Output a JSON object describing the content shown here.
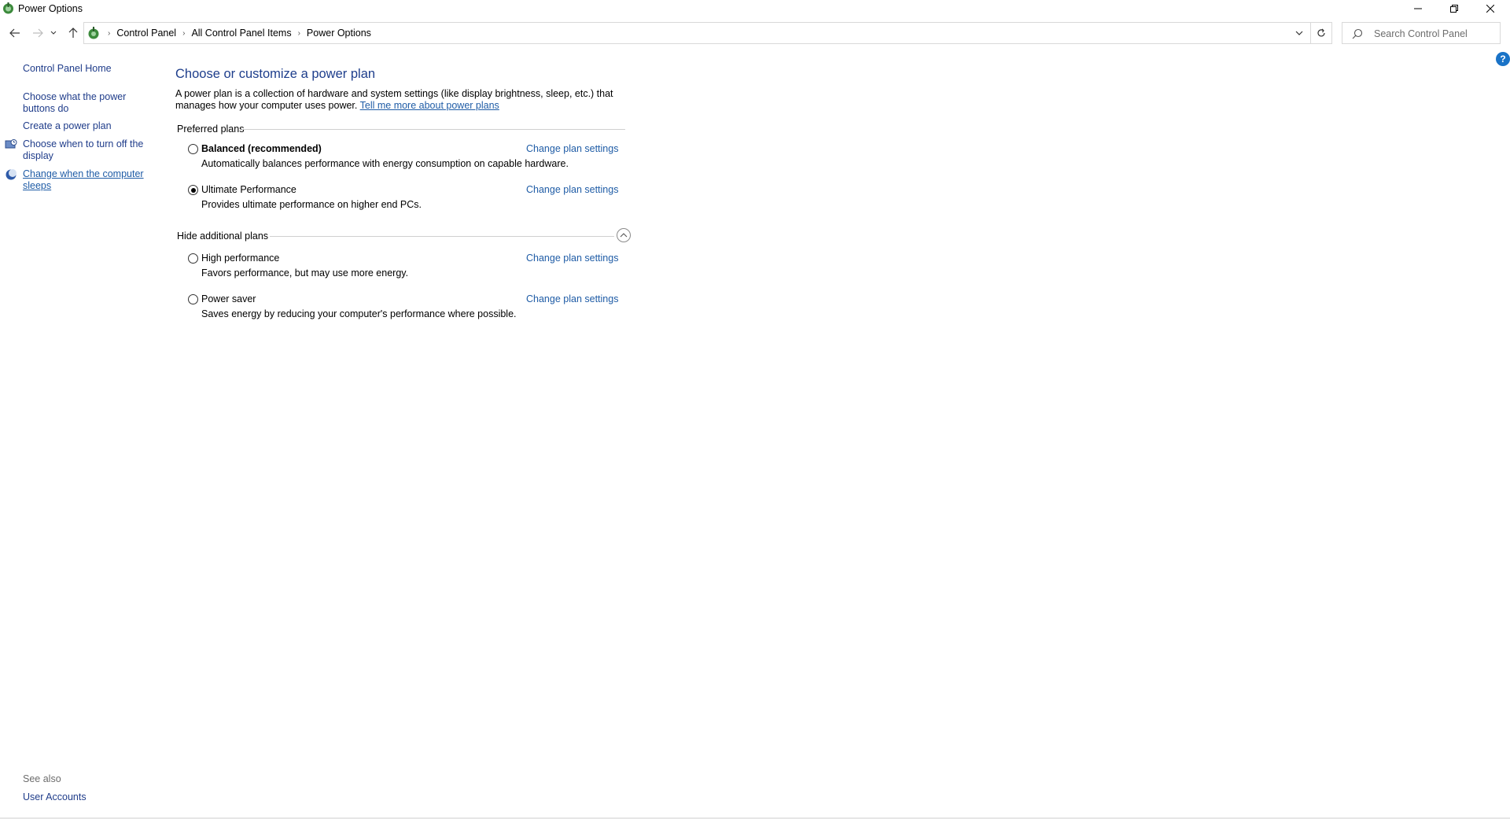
{
  "window": {
    "title": "Power Options"
  },
  "address": {
    "crumbs": [
      "Control Panel",
      "All Control Panel Items",
      "Power Options"
    ]
  },
  "search": {
    "placeholder": "Search Control Panel"
  },
  "left_pane": {
    "home": "Control Panel Home",
    "links": [
      "Choose what the power buttons do",
      "Create a power plan",
      "Choose when to turn off the display",
      "Change when the computer sleeps"
    ],
    "see_also_label": "See also",
    "see_also_links": [
      "User Accounts"
    ]
  },
  "main": {
    "title": "Choose or customize a power plan",
    "intro_text": "A power plan is a collection of hardware and system settings (like display brightness, sleep, etc.) that manages how your computer uses power.",
    "intro_link": "Tell me more about power plans",
    "preferred_heading": "Preferred plans",
    "additional_heading": "Hide additional plans",
    "change_label": "Change plan settings",
    "plans": [
      {
        "name": "Balanced (recommended)",
        "description": "Automatically balances performance with energy consumption on capable hardware.",
        "selected": false
      },
      {
        "name": "Ultimate Performance",
        "description": "Provides ultimate performance on higher end PCs.",
        "selected": true
      },
      {
        "name": "High performance",
        "description": "Favors performance, but may use more energy.",
        "selected": false
      },
      {
        "name": "Power saver",
        "description": "Saves energy by reducing your computer's performance where possible.",
        "selected": false
      }
    ]
  },
  "colors": {
    "link": "#1f5ca6",
    "title": "#1e3e8c",
    "help_icon": "#1a73c7"
  }
}
